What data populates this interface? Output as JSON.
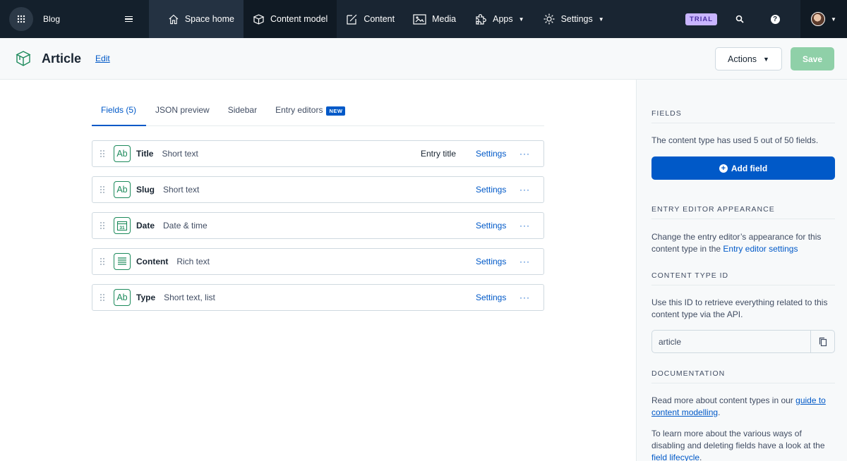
{
  "topnav": {
    "space_name": "Blog",
    "items": [
      {
        "label": "Space home",
        "icon": "home-icon"
      },
      {
        "label": "Content model",
        "icon": "content-model-icon"
      },
      {
        "label": "Content",
        "icon": "pen-icon"
      },
      {
        "label": "Media",
        "icon": "media-icon"
      },
      {
        "label": "Apps",
        "icon": "puzzle-icon"
      },
      {
        "label": "Settings",
        "icon": "gear-icon"
      }
    ],
    "trial_badge": "TRIAL"
  },
  "header": {
    "title": "Article",
    "edit_label": "Edit",
    "actions_label": "Actions",
    "save_label": "Save"
  },
  "tabs": {
    "fields": "Fields (5)",
    "json": "JSON preview",
    "sidebar": "Sidebar",
    "entry_editors": "Entry editors",
    "new_badge": "NEW"
  },
  "fields": [
    {
      "name": "Title",
      "type": "Short text",
      "extra": "Entry title",
      "icon": "text-icon",
      "settings": "Settings",
      "more": "···"
    },
    {
      "name": "Slug",
      "type": "Short text",
      "extra": "",
      "icon": "text-icon",
      "settings": "Settings",
      "more": "···"
    },
    {
      "name": "Date",
      "type": "Date & time",
      "extra": "",
      "icon": "calendar-icon",
      "settings": "Settings",
      "more": "···"
    },
    {
      "name": "Content",
      "type": "Rich text",
      "extra": "",
      "icon": "rich-text-icon",
      "settings": "Settings",
      "more": "···"
    },
    {
      "name": "Type",
      "type": "Short text, list",
      "extra": "",
      "icon": "text-icon",
      "settings": "Settings",
      "more": "···"
    }
  ],
  "text_icon_label": "Ab",
  "calendar_label": "31",
  "sidebar": {
    "fields_heading": "FIELDS",
    "fields_text": "The content type has used 5 out of 50 fields.",
    "add_field": "Add field",
    "appearance_heading": "ENTRY EDITOR APPEARANCE",
    "appearance_text": "Change the entry editor’s appearance for this content type in the",
    "appearance_link": "Entry editor settings",
    "id_heading": "CONTENT TYPE ID",
    "id_text": "Use this ID to retrieve everything related to this content type via the API.",
    "id_value": "article",
    "doc_heading": "DOCUMENTATION",
    "doc_text1": "Read more about content types in our",
    "doc_link1": "guide to content modelling",
    "doc_text2": "To learn more about the various ways of disabling and deleting fields have a look at the",
    "doc_link2": "field lifecycle"
  }
}
